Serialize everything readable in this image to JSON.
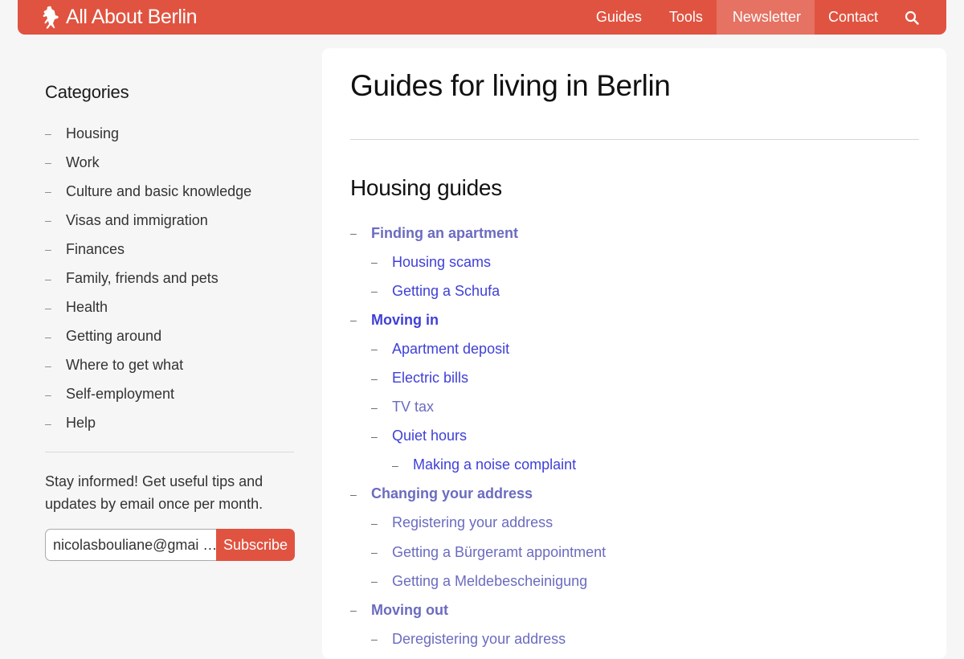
{
  "header": {
    "brand": "All About Berlin",
    "brand_icon": "berlin-bear-icon",
    "nav": [
      "Guides",
      "Tools",
      "Newsletter",
      "Contact"
    ],
    "search_icon": "search-icon",
    "active_nav": "Newsletter",
    "brand_color": "#e05340"
  },
  "sidebar": {
    "title": "Categories",
    "categories": [
      "Housing",
      "Work",
      "Culture and basic knowledge",
      "Visas and immigration",
      "Finances",
      "Family, friends and pets",
      "Health",
      "Getting around",
      "Where to get what",
      "Self-employment",
      "Help"
    ],
    "newsletter_text": "Stay informed! Get useful tips and updates by email once per month.",
    "email_value": "nicolasbouliane@gmai …",
    "subscribe_label": "Subscribe"
  },
  "main": {
    "title": "Guides for living in Berlin",
    "section_title": "Housing guides",
    "guides": [
      {
        "label": "Finding an apartment",
        "level": 0,
        "visited": true
      },
      {
        "label": "Housing scams",
        "level": 1,
        "visited": false
      },
      {
        "label": "Getting a Schufa",
        "level": 1,
        "visited": false
      },
      {
        "label": "Moving in",
        "level": 0,
        "visited": false
      },
      {
        "label": "Apartment deposit",
        "level": 1,
        "visited": false
      },
      {
        "label": "Electric bills",
        "level": 1,
        "visited": false
      },
      {
        "label": "TV tax",
        "level": 1,
        "visited": true
      },
      {
        "label": "Quiet hours",
        "level": 1,
        "visited": false
      },
      {
        "label": "Making a noise complaint",
        "level": 2,
        "visited": false
      },
      {
        "label": "Changing your address",
        "level": 0,
        "visited": true
      },
      {
        "label": "Registering your address",
        "level": 1,
        "visited": true
      },
      {
        "label": "Getting a Bürgeramt appointment",
        "level": 1,
        "visited": true
      },
      {
        "label": "Getting a Meldebescheinigung",
        "level": 1,
        "visited": true
      },
      {
        "label": "Moving out",
        "level": 0,
        "visited": true
      },
      {
        "label": "Deregistering your address",
        "level": 1,
        "visited": true
      }
    ],
    "link_color": "#3f3fd8",
    "visited_color": "#6b6bc0"
  }
}
